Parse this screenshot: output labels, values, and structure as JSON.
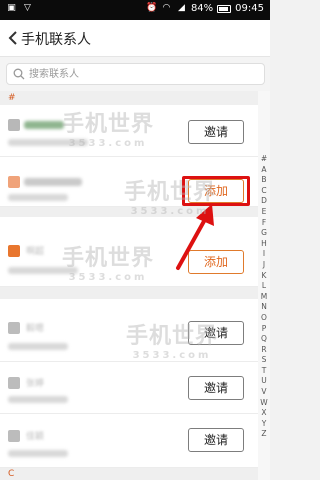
{
  "status_bar": {
    "battery": "84%",
    "time": "09:45",
    "left_icons": [
      "image-icon",
      "dropdown-icon"
    ],
    "right_icons": [
      "alarm-icon",
      "wifi-icon",
      "signal-icon",
      "battery-icon"
    ]
  },
  "header": {
    "title": "手机联系人",
    "back_icon": "chevron-left-icon"
  },
  "search": {
    "placeholder": "搜索联系人",
    "value": ""
  },
  "sections": {
    "hash": "#",
    "bottom": "C"
  },
  "contacts": [
    {
      "action": "邀请",
      "action_type": "invite"
    },
    {
      "action": "添加",
      "action_type": "add",
      "highlighted": true
    },
    {
      "name": "啊超",
      "action": "添加",
      "action_type": "add"
    },
    {
      "name": "毅嗯",
      "action": "邀请",
      "action_type": "invite"
    },
    {
      "name": "张婷",
      "action": "邀请",
      "action_type": "invite"
    },
    {
      "name": "佳颖",
      "action": "邀请",
      "action_type": "invite"
    }
  ],
  "index_letters": [
    "#",
    "A",
    "B",
    "C",
    "D",
    "E",
    "F",
    "G",
    "H",
    "I",
    "J",
    "K",
    "L",
    "M",
    "N",
    "O",
    "P",
    "Q",
    "R",
    "S",
    "T",
    "U",
    "V",
    "W",
    "X",
    "Y",
    "Z"
  ],
  "watermark": {
    "text": "手机世界",
    "sub": "3533.com"
  },
  "colors": {
    "accent": "#e06820",
    "highlight": "#dd1111",
    "status_bar": "#0b0b0b"
  }
}
